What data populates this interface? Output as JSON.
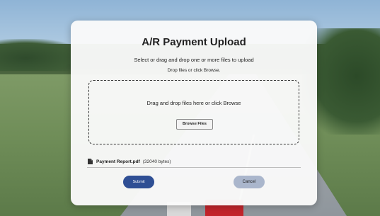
{
  "dialog": {
    "title": "A/R Payment Upload",
    "instruction": "Select or drag and drop one or more files to upload",
    "sub_instruction": "Drop files or click Browse."
  },
  "dropzone": {
    "text": "Drag and drop files here or click Browse",
    "browse_label": "Browse Files"
  },
  "files": [
    {
      "name": "Payment Report.pdf",
      "size": "(32040 bytes)",
      "icon": "file-icon"
    }
  ],
  "actions": {
    "submit_label": "Submit",
    "cancel_label": "Cancel"
  },
  "colors": {
    "submit_bg": "#2f4f94",
    "cancel_bg": "#aab6cc"
  }
}
